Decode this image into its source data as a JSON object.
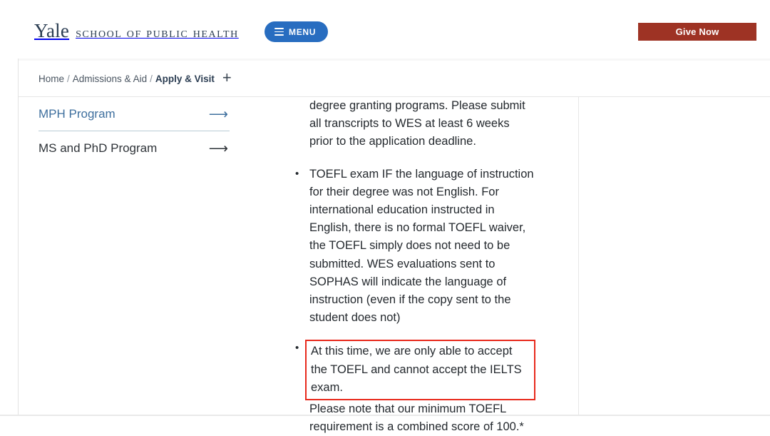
{
  "header": {
    "brand_primary": "Yale",
    "brand_secondary": "School of Public Health",
    "menu_label": "MENU",
    "give_now_label": "Give Now",
    "menu_color": "#286dc0",
    "give_now_color": "#9e3324",
    "brand_color": "#2b3d52"
  },
  "breadcrumb": {
    "items": [
      {
        "label": "Home"
      },
      {
        "label": "Admissions & Aid"
      },
      {
        "label": "Apply & Visit"
      }
    ],
    "separator": "/",
    "expand_icon": "+"
  },
  "sidebar": {
    "items": [
      {
        "label": "MPH Program",
        "arrow": "⟶",
        "active": true,
        "color": "#3e6f9e"
      },
      {
        "label": "MS and PhD Program",
        "arrow": "⟶",
        "active": false,
        "color": "#2e3338"
      }
    ]
  },
  "main": {
    "continued_paragraph": "degree granting programs. Please submit all transcripts to WES at least 6 weeks prior to the application deadline.",
    "bullets": [
      {
        "text": "TOEFL exam IF the language of instruction for their degree was not English. For international education instructed in English, there is no formal TOEFL waiver, the TOEFL simply does not need to be submitted. WES evaluations sent to SOPHAS will indicate the language of instruction (even if the copy sent to the student does not)",
        "highlighted": false
      },
      {
        "text": "At this time, we are only able to accept the TOEFL and cannot accept the IELTS exam.",
        "highlighted": true
      }
    ],
    "trailing_note": "Please note that our minimum TOEFL requirement is a combined score of 100.*"
  },
  "annotation": {
    "highlight_color": "#e8291c"
  }
}
